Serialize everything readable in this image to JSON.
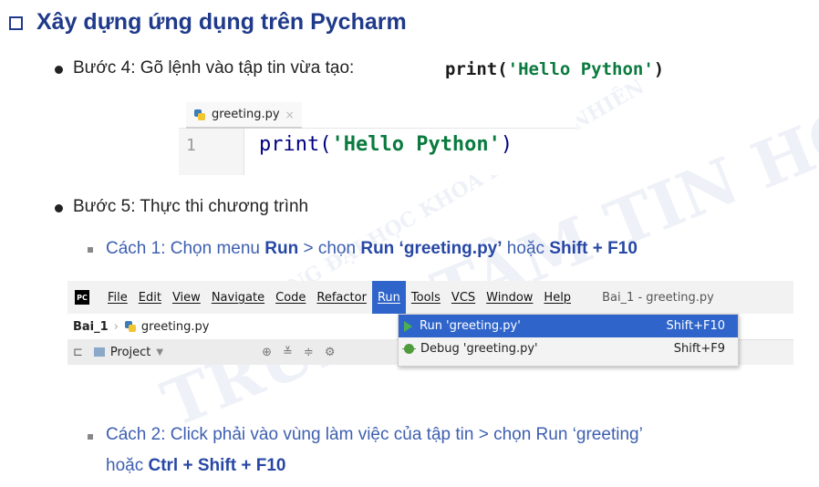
{
  "title": "Xây dựng ứng dụng trên Pycharm",
  "step4": {
    "text": "Bước 4: Gõ lệnh vào tập tin vừa tạo:",
    "code_fn": "print(",
    "code_str": "'Hello Python'",
    "code_end": ")"
  },
  "editor": {
    "tab_name": "greeting.py",
    "tab_close": "×",
    "line_number": "1",
    "code_fn": "print(",
    "code_str": "'Hello Python'",
    "code_end": ")"
  },
  "step5": {
    "text": "Bước 5: Thực thi chương trình"
  },
  "method1": {
    "prefix": "Cách 1: Chọn menu ",
    "run": "Run",
    "mid": " > chọn ",
    "run_file": "Run ‘greeting.py’",
    "or": " hoặc ",
    "shortcut": "Shift + F10"
  },
  "ide": {
    "logo": "PC",
    "menu": [
      "File",
      "Edit",
      "View",
      "Navigate",
      "Code",
      "Refactor",
      "Run",
      "Tools",
      "VCS",
      "Window",
      "Help"
    ],
    "window_title": "Bai_1 - greeting.py",
    "crumb_project": "Bai_1",
    "crumb_file": "greeting.py",
    "project_label": "Project",
    "dropdown": [
      {
        "label": "Run 'greeting.py'",
        "shortcut": "Shift+F10"
      },
      {
        "label": "Debug 'greeting.py'",
        "shortcut": "Shift+F9"
      }
    ]
  },
  "method2": {
    "line1": "Cách 2: Click phải vào vùng làm việc của tập tin > chọn Run ‘greeting’",
    "or": "hoặc ",
    "shortcut": "Ctrl + Shift + F10"
  },
  "watermark": {
    "line1": "TRUNG TÂM TIN HỌC",
    "line2": "TRƯỜNG ĐẠI HỌC KHOA HỌC TỰ NHIÊN"
  },
  "colors": {
    "title": "#1f3a8a",
    "accent": "#2f65ca",
    "sub_text": "#3d5fb0"
  }
}
